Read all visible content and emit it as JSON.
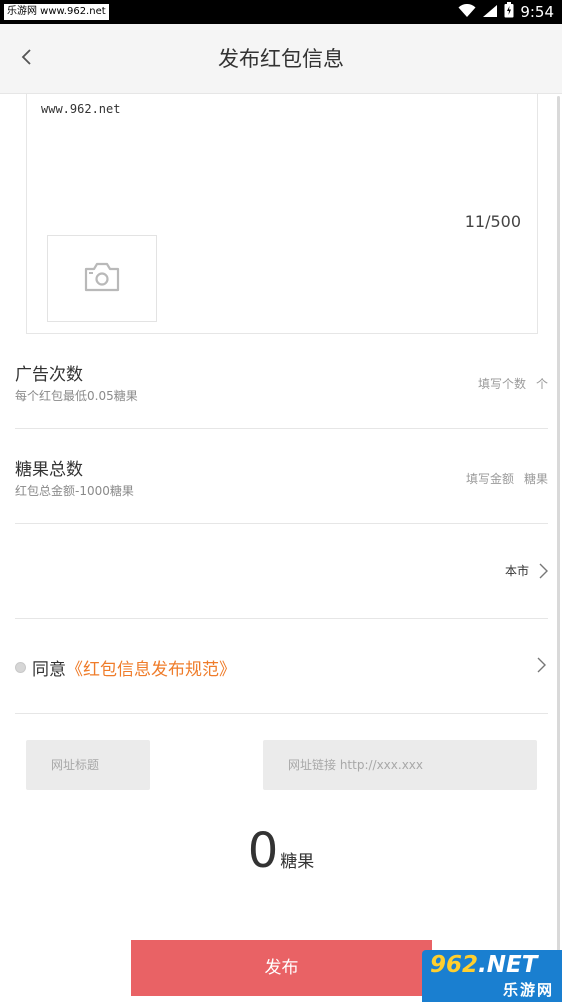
{
  "status_bar": {
    "watermark": "乐游网 www.962.net",
    "time": "9:54"
  },
  "header": {
    "title": "发布红包信息"
  },
  "editor": {
    "text": "www.962.net",
    "count": "11/500"
  },
  "ad_count": {
    "title": "广告次数",
    "subtitle": "每个红包最低0.05糖果",
    "placeholder": "填写个数",
    "unit": "个"
  },
  "candy_total": {
    "title": "糖果总数",
    "subtitle": "红包总金额-1000糖果",
    "placeholder": "填写金额",
    "unit": "糖果"
  },
  "region": {
    "value": "本市"
  },
  "agreement": {
    "prefix": "同意",
    "link": "《红包信息发布规范》"
  },
  "url_title": {
    "placeholder": "网址标题"
  },
  "url_link": {
    "placeholder": "网址链接 http://xxx.xxx"
  },
  "total": {
    "value": "0",
    "unit": "糖果"
  },
  "publish": {
    "label": "发布"
  },
  "watermark_logo": {
    "main": "962.NET",
    "main_prefix": "962",
    "main_suffix": ".NET",
    "sub": "乐游网"
  },
  "colors": {
    "accent_orange": "#ef7c2a",
    "publish_red": "#e96265",
    "header_bg": "#f5f5f5"
  }
}
